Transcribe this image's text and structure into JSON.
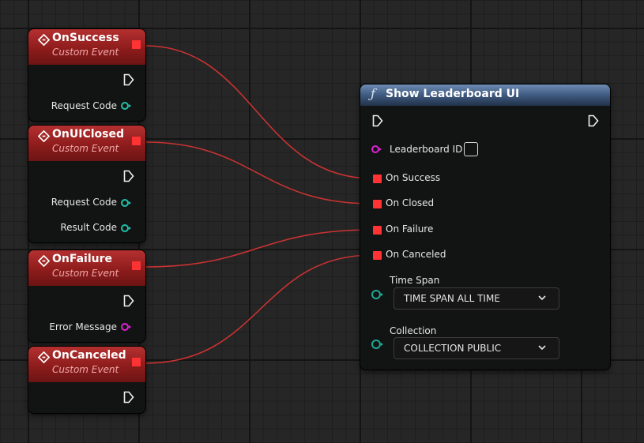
{
  "events": [
    {
      "title": "OnSuccess",
      "subtitle": "Custom Event",
      "outputs": [
        {
          "label": "Request Code",
          "pin_type": "integer"
        }
      ]
    },
    {
      "title": "OnUIClosed",
      "subtitle": "Custom Event",
      "outputs": [
        {
          "label": "Request Code",
          "pin_type": "integer"
        },
        {
          "label": "Result Code",
          "pin_type": "integer"
        }
      ]
    },
    {
      "title": "OnFailure",
      "subtitle": "Custom Event",
      "outputs": [
        {
          "label": "Error Message",
          "pin_type": "string"
        }
      ]
    },
    {
      "title": "OnCanceled",
      "subtitle": "Custom Event",
      "outputs": []
    }
  ],
  "function_node": {
    "icon": "function-f-icon",
    "title": "Show Leaderboard UI",
    "leaderboard_id_label": "Leaderboard ID",
    "leaderboard_id_value": "",
    "delegate_inputs": [
      "On Success",
      "On Closed",
      "On Failure",
      "On Canceled"
    ],
    "time_span_label": "Time Span",
    "time_span_value": "TIME SPAN ALL TIME",
    "collection_label": "Collection",
    "collection_value": "COLLECTION PUBLIC"
  },
  "colors": {
    "event_header": "#8e1c1c",
    "function_header": "#3e5a80",
    "wire": "#c93232",
    "delegate_pin": "#ff3333",
    "integer_pin": "#20c0a8",
    "string_pin": "#e020d8",
    "background": "#262626"
  }
}
